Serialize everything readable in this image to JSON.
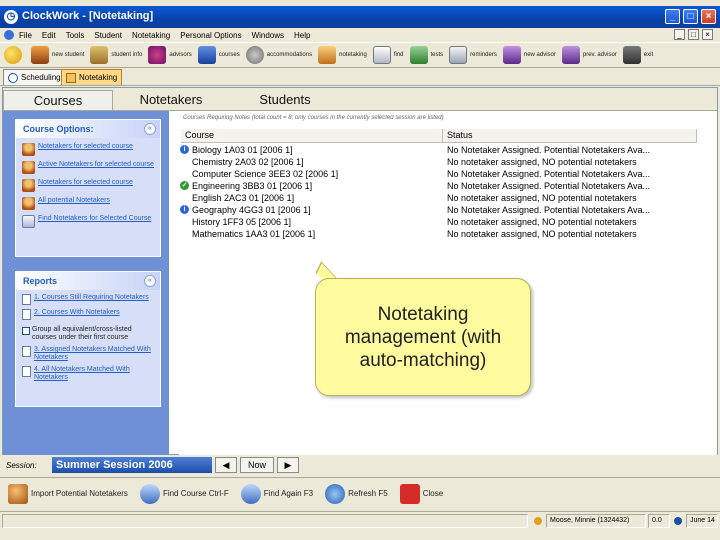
{
  "window": {
    "title": "ClockWork - [Notetaking]",
    "minimize_glyph": "_",
    "maximize_glyph": "□",
    "close_glyph": "×"
  },
  "menubar": {
    "items": [
      "File",
      "Edit",
      "Tools",
      "Student",
      "Notetaking",
      "Personal Options",
      "Windows",
      "Help"
    ],
    "mdi_controls": [
      "_",
      "□",
      "×"
    ]
  },
  "toolbar": {
    "buttons": [
      {
        "label": "",
        "icon": "clock-icon"
      },
      {
        "label": "new student",
        "icon": "new-student-icon"
      },
      {
        "label": "student info",
        "icon": "student-info-icon"
      },
      {
        "label": "advisors",
        "icon": "advisors-icon"
      },
      {
        "label": "courses",
        "icon": "courses-icon"
      },
      {
        "label": "accommodations",
        "icon": "accommodations-icon"
      },
      {
        "label": "notetaking",
        "icon": "notetaking-icon"
      },
      {
        "label": "find",
        "icon": "find-icon"
      },
      {
        "label": "tests",
        "icon": "tests-icon"
      },
      {
        "label": "reminders",
        "icon": "reminders-icon"
      },
      {
        "label": "new advisor",
        "icon": "new-advisor-icon"
      },
      {
        "label": "prev. advisor",
        "icon": "prev-advisor-icon"
      },
      {
        "label": "exit",
        "icon": "exit-icon"
      }
    ]
  },
  "mdi_tabs": [
    {
      "label": "Scheduling",
      "active": false
    },
    {
      "label": "Notetaking",
      "active": true
    }
  ],
  "tabs": {
    "courses": "Courses",
    "notetakers": "Notetakers",
    "students": "Students"
  },
  "course_options": {
    "title": "Course Options:",
    "collapse_glyph": "«",
    "items": [
      "Notetakers for selected course",
      "Active Notetakers for selected course",
      "Notetakers for selected course",
      "All potential Notetakers",
      "Find Notetakers for Selected Course"
    ]
  },
  "reports": {
    "title": "Reports",
    "collapse_glyph": "«",
    "items": [
      "1. Courses Still Requiring Notetakers",
      "2. Courses With Notetakers"
    ],
    "checkbox_label": "Group all equivalent/cross-listed courses under their first course",
    "items_after": [
      "3. Assigned Notetakers Matched With Notetakers",
      "4. All Notetakers Matched With Notetakers"
    ]
  },
  "grid": {
    "caption": "Courses Requiring Notes (total count = 8; only courses in the currently selected session are listed)",
    "columns": [
      "Course",
      "Status"
    ],
    "rows": [
      {
        "icon": "info",
        "glyph": "i",
        "course": "Biology 1A03 01 [2006 1]",
        "status": "No Notetaker Assigned. Potential Notetakers Ava..."
      },
      {
        "icon": "",
        "glyph": "",
        "course": "Chemistry 2A03 02 [2006 1]",
        "status": "No notetaker assigned, NO potential notetakers"
      },
      {
        "icon": "",
        "glyph": "",
        "course": "Computer Science 3EE3 02 [2006 1]",
        "status": "No Notetaker Assigned. Potential Notetakers Ava..."
      },
      {
        "icon": "ok",
        "glyph": "✓",
        "course": "Engineering 3BB3 01 [2006 1]",
        "status": "No Notetaker Assigned. Potential Notetakers Ava..."
      },
      {
        "icon": "",
        "glyph": "",
        "course": "English 2AC3 01 [2006 1]",
        "status": "No notetaker assigned, NO potential notetakers"
      },
      {
        "icon": "info",
        "glyph": "i",
        "course": "Geography 4GG3 01 [2006 1]",
        "status": "No Notetaker Assigned. Potential Notetakers Ava..."
      },
      {
        "icon": "",
        "glyph": "",
        "course": "History 1FF3 05 [2006 1]",
        "status": "No notetaker assigned, NO potential notetakers"
      },
      {
        "icon": "",
        "glyph": "",
        "course": "Mathematics 1AA3 01 [2006 1]",
        "status": "No notetaker assigned, NO potential notetakers"
      }
    ]
  },
  "callout": {
    "text": "Notetaking management (with auto-matching)"
  },
  "session": {
    "label": "Session:",
    "value": "Summer Session 2006",
    "prev_glyph": "◀",
    "now_label": "Now",
    "next_glyph": "▶"
  },
  "actions": [
    {
      "label": "Import Potential Notetakers",
      "icon": "import-icon"
    },
    {
      "label": "Find Course Ctrl-F",
      "icon": "find-course-icon"
    },
    {
      "label": "Find Again F3",
      "icon": "find-again-icon"
    },
    {
      "label": "Refresh F5",
      "icon": "refresh-icon"
    },
    {
      "label": "Close",
      "icon": "close-icon"
    }
  ],
  "statusbar": {
    "user": "Moose, Minnie (1324432)",
    "indicator": "0.0",
    "date": "June 14"
  },
  "colors": {
    "titlebar": "#0a5bd6",
    "task_pane": "#6f8fd6",
    "callout": "#fffb9e",
    "session_field": "#1a4ea8"
  }
}
